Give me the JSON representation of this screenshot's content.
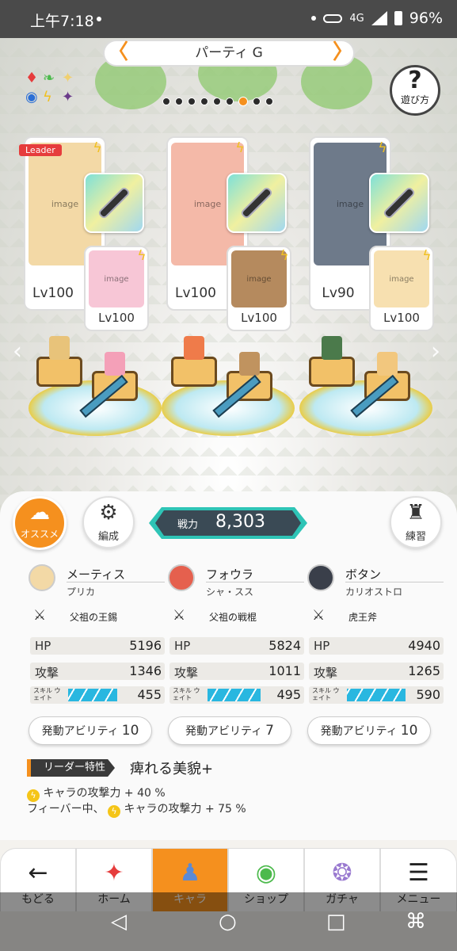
{
  "status_bar": {
    "time": "上午7:18",
    "network": "4G",
    "battery": "96%"
  },
  "header": {
    "party_name": "パーティ G",
    "help_label": "遊び方",
    "help_glyph": "?",
    "arrow_left": "〈",
    "arrow_right": "〉",
    "page_count": 9,
    "active_page": 7
  },
  "leader_badge": "Leader",
  "slots": [
    {
      "main_level": "Lv100",
      "sub_level": "Lv100",
      "portrait_color": "#f3d9a6",
      "sub_color": "#f7c6d6"
    },
    {
      "main_level": "Lv100",
      "sub_level": "Lv100",
      "portrait_color": "#f4b9a8",
      "sub_color": "#b58a5e"
    },
    {
      "main_level": "Lv90",
      "sub_level": "Lv100",
      "portrait_color": "#6e7a8a",
      "sub_color": "#f7e0b0"
    }
  ],
  "actions": {
    "recommend_label": "オススメ",
    "edit_label": "編成",
    "practice_label": "練習",
    "power_label": "戦力",
    "power_value": "8,303"
  },
  "characters": [
    {
      "name": "メーティス",
      "title": "プリカ",
      "weapon": "父祖の王錫",
      "hp_label": "HP",
      "hp": "5196",
      "atk_label": "攻撃",
      "atk": "1346",
      "skill_label": "スキル ウェイト",
      "skill_wait": "455",
      "skill_fill": 0.72,
      "ability_label": "発動アビリティ",
      "ability_count": "10",
      "avatar_color": "#f3d9a6"
    },
    {
      "name": "フォウラ",
      "title": "シャ・スス",
      "weapon": "父祖の戦棍",
      "hp_label": "HP",
      "hp": "5824",
      "atk_label": "攻撃",
      "atk": "1011",
      "skill_label": "スキル ウェイト",
      "skill_wait": "495",
      "skill_fill": 0.78,
      "ability_label": "発動アビリティ",
      "ability_count": "7",
      "avatar_color": "#e5604e"
    },
    {
      "name": "ボタン",
      "title": "カリオストロ",
      "weapon": "虎王斧",
      "hp_label": "HP",
      "hp": "4940",
      "atk_label": "攻撃",
      "atk": "1265",
      "skill_label": "スキル ウェイト",
      "skill_wait": "590",
      "skill_fill": 0.86,
      "ability_label": "発動アビリティ",
      "ability_count": "10",
      "avatar_color": "#3a3f4a"
    }
  ],
  "leader_skill": {
    "tag": "リーダー特性",
    "name": "痺れる美貌+",
    "effect_1": "キャラの攻撃力 + 40 %",
    "effect_2_prefix": "フィーバー中、",
    "effect_2": "キャラの攻撃力 + 75 %"
  },
  "tabs": [
    {
      "label": "もどる",
      "icon": "back-arrow-icon",
      "glyph": "←"
    },
    {
      "label": "ホーム",
      "icon": "home-icon",
      "glyph": "✦"
    },
    {
      "label": "キャラ",
      "icon": "character-icon",
      "glyph": "♟"
    },
    {
      "label": "ショップ",
      "icon": "shop-icon",
      "glyph": "◉"
    },
    {
      "label": "ガチャ",
      "icon": "gacha-icon",
      "glyph": "❂"
    },
    {
      "label": "メニュー",
      "icon": "menu-icon",
      "glyph": "☰"
    }
  ],
  "colors": {
    "accent": "#f5901e",
    "power": "#2ec4b6",
    "skill": "#29b7e0"
  }
}
